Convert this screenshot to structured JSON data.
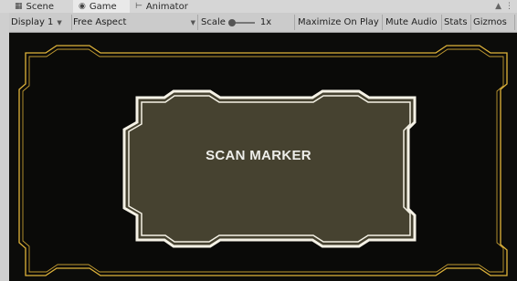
{
  "tabs": [
    {
      "label": "Scene",
      "icon": "grid-icon"
    },
    {
      "label": "Game",
      "icon": "gamepad-icon"
    },
    {
      "label": "Animator",
      "icon": "animator-icon"
    }
  ],
  "toolbar": {
    "display": "Display 1",
    "aspect": "Free Aspect",
    "scale_label": "Scale",
    "scale_value": "1x",
    "maximize": "Maximize On Play",
    "mute": "Mute Audio",
    "stats": "Stats",
    "gizmos": "Gizmos"
  },
  "game_view": {
    "panel_text": "SCAN MARKER",
    "colors": {
      "outer_frame": "#e0b43a",
      "inner_fill": "#464230",
      "inner_outline": "#f5f2e6",
      "background": "#0c0c0a"
    }
  }
}
